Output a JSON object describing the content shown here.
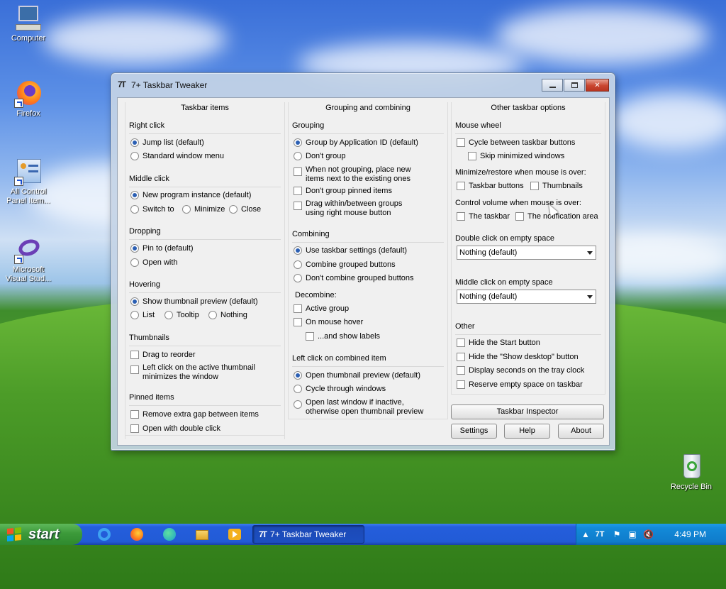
{
  "desktop": {
    "icons": [
      {
        "label": "Computer"
      },
      {
        "label": "Firefox"
      },
      {
        "label": "All Control Panel Item..."
      },
      {
        "label": "Microsoft Visual Stud..."
      },
      {
        "label": "Recycle Bin"
      }
    ]
  },
  "window": {
    "title": "7+ Taskbar Tweaker",
    "icon_glyph": "7T"
  },
  "col1": {
    "header": "Taskbar items",
    "right_click": {
      "title": "Right click",
      "opt1": "Jump list (default)",
      "opt2": "Standard window menu"
    },
    "middle_click": {
      "title": "Middle click",
      "opt1": "New program instance (default)",
      "opt2": "Switch to",
      "opt3": "Minimize",
      "opt4": "Close"
    },
    "dropping": {
      "title": "Dropping",
      "opt1": "Pin to (default)",
      "opt2": "Open with"
    },
    "hovering": {
      "title": "Hovering",
      "opt1": "Show thumbnail preview (default)",
      "opt2": "List",
      "opt3": "Tooltip",
      "opt4": "Nothing"
    },
    "thumbnails": {
      "title": "Thumbnails",
      "opt1": "Drag to reorder",
      "opt2": "Left click on the active thumbnail minimizes the window"
    },
    "pinned": {
      "title": "Pinned items",
      "opt1": "Remove extra gap between items",
      "opt2": "Open with double click"
    }
  },
  "col2": {
    "header": "Grouping and combining",
    "grouping": {
      "title": "Grouping",
      "opt1": "Group by Application ID (default)",
      "opt2": "Don't group",
      "opt3": "When not grouping, place new items next to the existing ones",
      "opt4": "Don't group pinned items",
      "opt5": "Drag within/between groups using right mouse button"
    },
    "combining": {
      "title": "Combining",
      "opt1": "Use taskbar settings (default)",
      "opt2": "Combine grouped buttons",
      "opt3": "Don't combine grouped buttons"
    },
    "decombine": {
      "title": "Decombine:",
      "opt1": "Active group",
      "opt2": "On mouse hover",
      "opt3": "...and show labels"
    },
    "left_click": {
      "title": "Left click on combined item",
      "opt1": "Open thumbnail preview (default)",
      "opt2": "Cycle through windows",
      "opt3": "Open last window if inactive, otherwise open thumbnail preview"
    }
  },
  "col3": {
    "header": "Other taskbar options",
    "wheel": {
      "title": "Mouse wheel",
      "opt1": "Cycle between taskbar buttons",
      "opt2": "Skip minimized windows"
    },
    "minrestore": {
      "title": "Minimize/restore when mouse is over:",
      "opt1": "Taskbar buttons",
      "opt2": "Thumbnails"
    },
    "volume": {
      "title": "Control volume when mouse is over:",
      "opt1": "The taskbar",
      "opt2": "The notification area"
    },
    "dblclick": {
      "title": "Double click on empty space",
      "value": "Nothing (default)"
    },
    "midclick": {
      "title": "Middle click on empty space",
      "value": "Nothing (default)"
    },
    "other": {
      "title": "Other",
      "opt1": "Hide the Start button",
      "opt2": "Hide the \"Show desktop\" button",
      "opt3": "Display seconds on the tray clock",
      "opt4": "Reserve empty space on taskbar"
    },
    "inspector_label": "Taskbar Inspector",
    "settings_label": "Settings",
    "help_label": "Help",
    "about_label": "About"
  },
  "taskbar": {
    "start_label": "start",
    "task_label": "7+ Taskbar Tweaker",
    "task_icon": "7T",
    "clock": "4:49 PM"
  },
  "colors": {
    "accent": "#245edc",
    "start_green": "#3c9a3a",
    "tray_blue": "#138ad8",
    "radio_dot": "#2b5fb3"
  }
}
